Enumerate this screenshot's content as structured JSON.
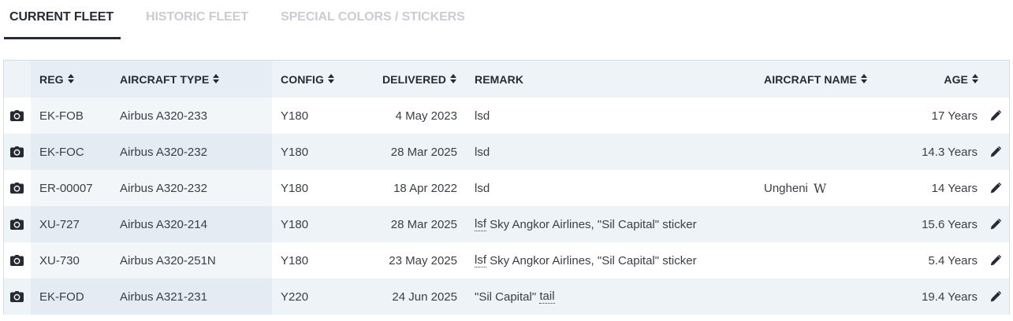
{
  "tabs": [
    {
      "label": "CURRENT FLEET",
      "active": true
    },
    {
      "label": "HISTORIC FLEET",
      "active": false
    },
    {
      "label": "SPECIAL COLORS / STICKERS",
      "active": false
    }
  ],
  "table": {
    "headers": {
      "reg": "REG",
      "type": "AIRCRAFT TYPE",
      "config": "CONFIG",
      "delivered": "DELIVERED",
      "remark": "REMARK",
      "name": "AIRCRAFT NAME",
      "age": "AGE"
    },
    "rows": [
      {
        "reg": "EK-FOB",
        "type": "Airbus A320-233",
        "config": "Y180",
        "delivered": "4 May 2023",
        "remark_abbr": "",
        "remark": "lsd",
        "name": "",
        "age": "17 Years"
      },
      {
        "reg": "EK-FOC",
        "type": "Airbus A320-232",
        "config": "Y180",
        "delivered": "28 Mar 2025",
        "remark_abbr": "",
        "remark": "lsd",
        "name": "",
        "age": "14.3 Years"
      },
      {
        "reg": "ER-00007",
        "type": "Airbus A320-232",
        "config": "Y180",
        "delivered": "18 Apr 2022",
        "remark_abbr": "",
        "remark": "lsd",
        "name": "Ungheni",
        "age": "14 Years"
      },
      {
        "reg": "XU-727",
        "type": "Airbus A320-214",
        "config": "Y180",
        "delivered": "28 Mar 2025",
        "remark_abbr": "lsf",
        "remark": " Sky Angkor Airlines, \"Sil Capital\" sticker",
        "name": "",
        "age": "15.6 Years"
      },
      {
        "reg": "XU-730",
        "type": "Airbus A320-251N",
        "config": "Y180",
        "delivered": "23 May 2025",
        "remark_abbr": "lsf",
        "remark": " Sky Angkor Airlines, \"Sil Capital\" sticker",
        "name": "",
        "age": "5.4 Years"
      },
      {
        "reg": "EK-FOD",
        "type": "Airbus A321-231",
        "config": "Y220",
        "delivered": "24 Jun 2025",
        "remark_abbr": "",
        "remark": "\"Sil Capital\" ",
        "remark_tail": "tail",
        "name": "",
        "age": "19.4 Years"
      }
    ]
  },
  "icons": {
    "camera": "camera-icon",
    "edit": "pencil-icon",
    "wiki": "wikipedia-icon",
    "sort": "sort-icon"
  },
  "wiki_glyph": "W",
  "colors": {
    "text_dark": "#262b33",
    "tab_inactive": "#c9cdd2",
    "row_alt": "#eef3f7",
    "sorted_column": "#e6edf4"
  }
}
